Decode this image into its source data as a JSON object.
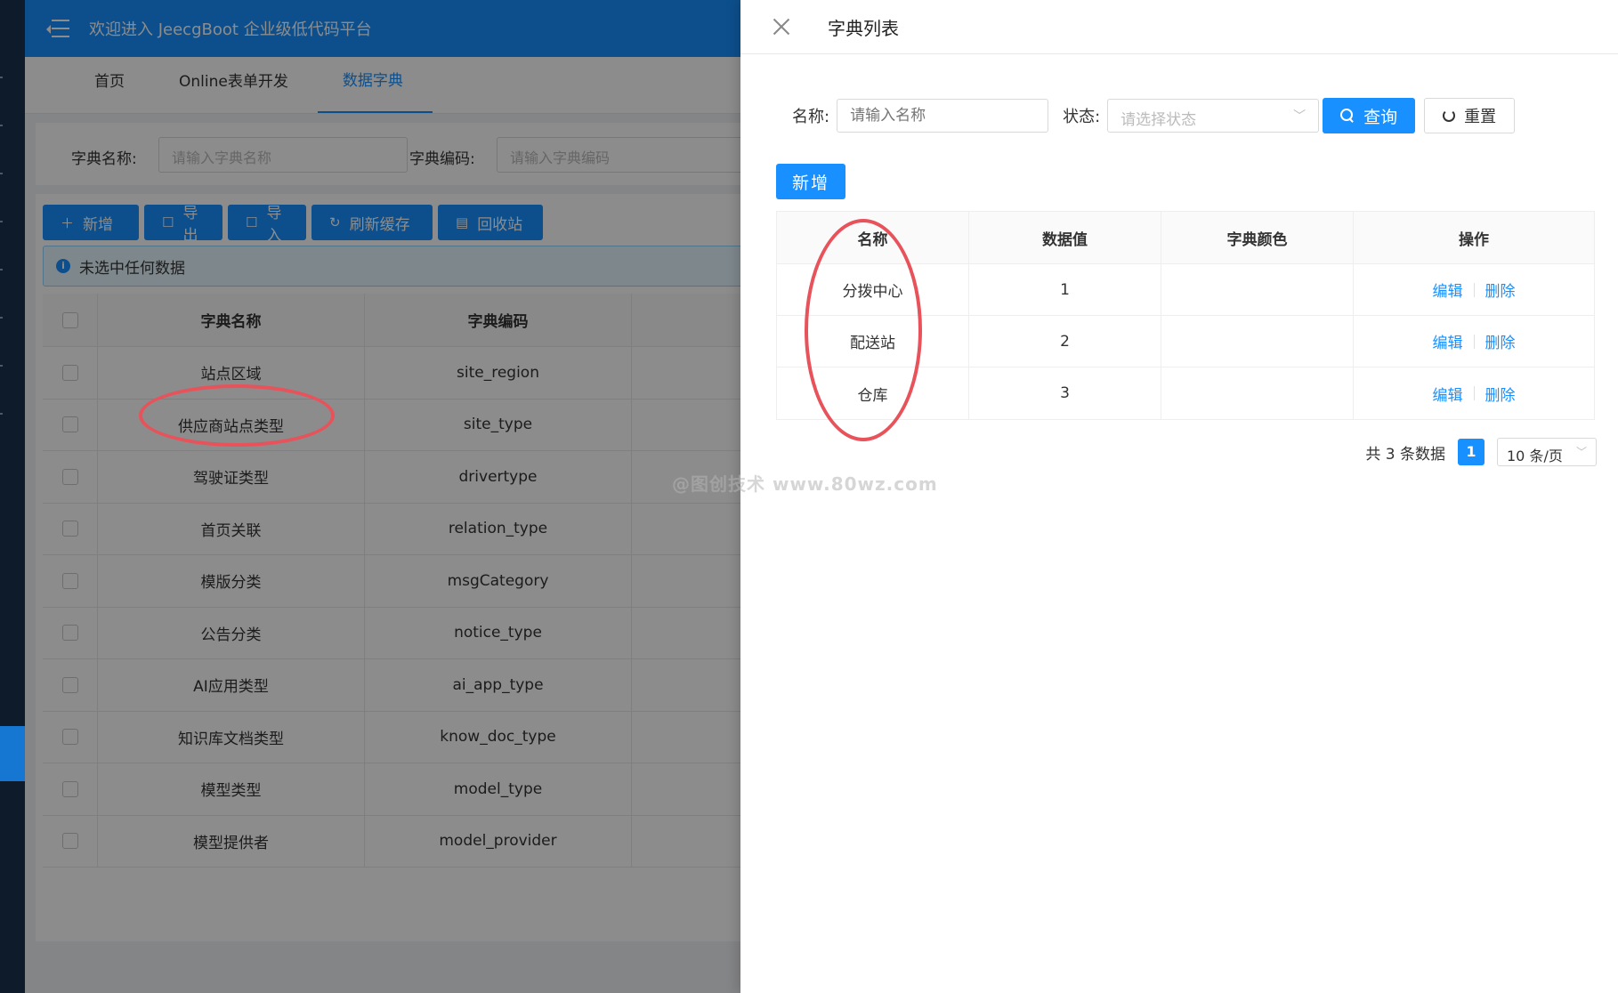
{
  "header": {
    "title": "欢迎进入 JeecgBoot 企业级低代码平台"
  },
  "tabs": [
    {
      "label": "首页"
    },
    {
      "label": "Online表单开发"
    },
    {
      "label": "数据字典"
    }
  ],
  "bg_search": {
    "name_label": "字典名称:",
    "name_placeholder": "请输入字典名称",
    "code_label": "字典编码:",
    "code_placeholder": "请输入字典编码"
  },
  "toolbar": {
    "add": "新增",
    "export": "导出",
    "import": "导入",
    "refresh": "刷新缓存",
    "recycle": "回收站"
  },
  "alert": {
    "text": "未选中任何数据"
  },
  "dict_table": {
    "headers": [
      "字典名称",
      "字典编码"
    ],
    "rows": [
      {
        "name": "站点区域",
        "code": "site_region"
      },
      {
        "name": "供应商站点类型",
        "code": "site_type"
      },
      {
        "name": "驾驶证类型",
        "code": "drivertype"
      },
      {
        "name": "首页关联",
        "code": "relation_type"
      },
      {
        "name": "模版分类",
        "code": "msgCategory"
      },
      {
        "name": "公告分类",
        "code": "notice_type"
      },
      {
        "name": "AI应用类型",
        "code": "ai_app_type"
      },
      {
        "name": "知识库文档类型",
        "code": "know_doc_type"
      },
      {
        "name": "模型类型",
        "code": "model_type"
      },
      {
        "name": "模型提供者",
        "code": "model_provider"
      }
    ]
  },
  "drawer": {
    "title": "字典列表",
    "name_label": "名称:",
    "name_placeholder": "请输入名称",
    "status_label": "状态:",
    "status_placeholder": "请选择状态",
    "query_button": "查询",
    "reset_button": "重置",
    "add_button": "新增",
    "headers": [
      "名称",
      "数据值",
      "字典颜色",
      "操作"
    ],
    "rows": [
      {
        "name": "分拨中心",
        "value": "1",
        "color": "",
        "edit": "编辑",
        "delete": "删除"
      },
      {
        "name": "配送站",
        "value": "2",
        "color": "",
        "edit": "编辑",
        "delete": "删除"
      },
      {
        "name": "仓库",
        "value": "3",
        "color": "",
        "edit": "编辑",
        "delete": "删除"
      }
    ],
    "pager": {
      "total": "共 3 条数据",
      "page": "1",
      "size": "10 条/页"
    }
  },
  "watermark": "@图创技术 www.80wz.com",
  "colors": {
    "primary": "#1890ff",
    "annotation": "#e8525a",
    "sidebar": "#0d1b2a"
  }
}
